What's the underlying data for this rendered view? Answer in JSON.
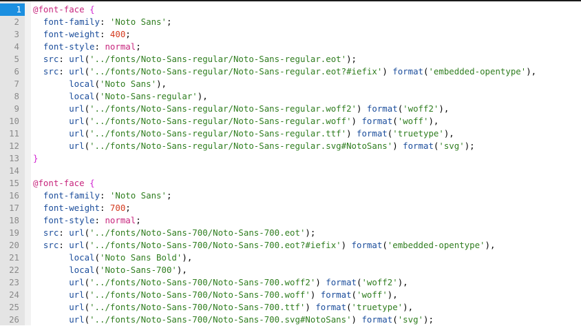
{
  "editor": {
    "current_line": 1,
    "lines": [
      {
        "n": "1",
        "tokens": [
          {
            "c": "t-at",
            "t": "@font-face"
          },
          {
            "c": "t-plain",
            "t": " "
          },
          {
            "c": "t-brace",
            "t": "{"
          }
        ]
      },
      {
        "n": "2",
        "tokens": [
          {
            "c": "t-plain",
            "t": "  "
          },
          {
            "c": "t-prop",
            "t": "font-family"
          },
          {
            "c": "t-plain",
            "t": ": "
          },
          {
            "c": "t-str",
            "t": "'Noto Sans'"
          },
          {
            "c": "t-plain",
            "t": ";"
          }
        ]
      },
      {
        "n": "3",
        "tokens": [
          {
            "c": "t-plain",
            "t": "  "
          },
          {
            "c": "t-prop",
            "t": "font-weight"
          },
          {
            "c": "t-plain",
            "t": ": "
          },
          {
            "c": "t-num",
            "t": "400"
          },
          {
            "c": "t-plain",
            "t": ";"
          }
        ]
      },
      {
        "n": "4",
        "tokens": [
          {
            "c": "t-plain",
            "t": "  "
          },
          {
            "c": "t-prop",
            "t": "font-style"
          },
          {
            "c": "t-plain",
            "t": ": "
          },
          {
            "c": "t-val",
            "t": "normal"
          },
          {
            "c": "t-plain",
            "t": ";"
          }
        ]
      },
      {
        "n": "5",
        "tokens": [
          {
            "c": "t-plain",
            "t": "  "
          },
          {
            "c": "t-prop",
            "t": "src"
          },
          {
            "c": "t-plain",
            "t": ": "
          },
          {
            "c": "t-fn",
            "t": "url"
          },
          {
            "c": "t-plain",
            "t": "("
          },
          {
            "c": "t-str",
            "t": "'../fonts/Noto-Sans-regular/Noto-Sans-regular.eot'"
          },
          {
            "c": "t-plain",
            "t": ");"
          }
        ]
      },
      {
        "n": "6",
        "tokens": [
          {
            "c": "t-plain",
            "t": "  "
          },
          {
            "c": "t-prop",
            "t": "src"
          },
          {
            "c": "t-plain",
            "t": ": "
          },
          {
            "c": "t-fn",
            "t": "url"
          },
          {
            "c": "t-plain",
            "t": "("
          },
          {
            "c": "t-str",
            "t": "'../fonts/Noto-Sans-regular/Noto-Sans-regular.eot?#iefix'"
          },
          {
            "c": "t-plain",
            "t": ") "
          },
          {
            "c": "t-fn",
            "t": "format"
          },
          {
            "c": "t-plain",
            "t": "("
          },
          {
            "c": "t-str",
            "t": "'embedded-opentype'"
          },
          {
            "c": "t-plain",
            "t": "),"
          }
        ]
      },
      {
        "n": "7",
        "tokens": [
          {
            "c": "t-plain",
            "t": "       "
          },
          {
            "c": "t-fn",
            "t": "local"
          },
          {
            "c": "t-plain",
            "t": "("
          },
          {
            "c": "t-str",
            "t": "'Noto Sans'"
          },
          {
            "c": "t-plain",
            "t": "),"
          }
        ]
      },
      {
        "n": "8",
        "tokens": [
          {
            "c": "t-plain",
            "t": "       "
          },
          {
            "c": "t-fn",
            "t": "local"
          },
          {
            "c": "t-plain",
            "t": "("
          },
          {
            "c": "t-str",
            "t": "'Noto-Sans-regular'"
          },
          {
            "c": "t-plain",
            "t": "),"
          }
        ]
      },
      {
        "n": "9",
        "tokens": [
          {
            "c": "t-plain",
            "t": "       "
          },
          {
            "c": "t-fn",
            "t": "url"
          },
          {
            "c": "t-plain",
            "t": "("
          },
          {
            "c": "t-str",
            "t": "'../fonts/Noto-Sans-regular/Noto-Sans-regular.woff2'"
          },
          {
            "c": "t-plain",
            "t": ") "
          },
          {
            "c": "t-fn",
            "t": "format"
          },
          {
            "c": "t-plain",
            "t": "("
          },
          {
            "c": "t-str",
            "t": "'woff2'"
          },
          {
            "c": "t-plain",
            "t": "),"
          }
        ]
      },
      {
        "n": "10",
        "tokens": [
          {
            "c": "t-plain",
            "t": "       "
          },
          {
            "c": "t-fn",
            "t": "url"
          },
          {
            "c": "t-plain",
            "t": "("
          },
          {
            "c": "t-str",
            "t": "'../fonts/Noto-Sans-regular/Noto-Sans-regular.woff'"
          },
          {
            "c": "t-plain",
            "t": ") "
          },
          {
            "c": "t-fn",
            "t": "format"
          },
          {
            "c": "t-plain",
            "t": "("
          },
          {
            "c": "t-str",
            "t": "'woff'"
          },
          {
            "c": "t-plain",
            "t": "),"
          }
        ]
      },
      {
        "n": "11",
        "tokens": [
          {
            "c": "t-plain",
            "t": "       "
          },
          {
            "c": "t-fn",
            "t": "url"
          },
          {
            "c": "t-plain",
            "t": "("
          },
          {
            "c": "t-str",
            "t": "'../fonts/Noto-Sans-regular/Noto-Sans-regular.ttf'"
          },
          {
            "c": "t-plain",
            "t": ") "
          },
          {
            "c": "t-fn",
            "t": "format"
          },
          {
            "c": "t-plain",
            "t": "("
          },
          {
            "c": "t-str",
            "t": "'truetype'"
          },
          {
            "c": "t-plain",
            "t": "),"
          }
        ]
      },
      {
        "n": "12",
        "tokens": [
          {
            "c": "t-plain",
            "t": "       "
          },
          {
            "c": "t-fn",
            "t": "url"
          },
          {
            "c": "t-plain",
            "t": "("
          },
          {
            "c": "t-str",
            "t": "'../fonts/Noto-Sans-regular/Noto-Sans-regular.svg#NotoSans'"
          },
          {
            "c": "t-plain",
            "t": ") "
          },
          {
            "c": "t-fn",
            "t": "format"
          },
          {
            "c": "t-plain",
            "t": "("
          },
          {
            "c": "t-str",
            "t": "'svg'"
          },
          {
            "c": "t-plain",
            "t": ");"
          }
        ]
      },
      {
        "n": "13",
        "tokens": [
          {
            "c": "t-brace",
            "t": "}"
          }
        ]
      },
      {
        "n": "14",
        "tokens": []
      },
      {
        "n": "15",
        "tokens": [
          {
            "c": "t-at",
            "t": "@font-face"
          },
          {
            "c": "t-plain",
            "t": " "
          },
          {
            "c": "t-brace",
            "t": "{"
          }
        ]
      },
      {
        "n": "16",
        "tokens": [
          {
            "c": "t-plain",
            "t": "  "
          },
          {
            "c": "t-prop",
            "t": "font-family"
          },
          {
            "c": "t-plain",
            "t": ": "
          },
          {
            "c": "t-str",
            "t": "'Noto Sans'"
          },
          {
            "c": "t-plain",
            "t": ";"
          }
        ]
      },
      {
        "n": "17",
        "tokens": [
          {
            "c": "t-plain",
            "t": "  "
          },
          {
            "c": "t-prop",
            "t": "font-weight"
          },
          {
            "c": "t-plain",
            "t": ": "
          },
          {
            "c": "t-num",
            "t": "700"
          },
          {
            "c": "t-plain",
            "t": ";"
          }
        ]
      },
      {
        "n": "18",
        "tokens": [
          {
            "c": "t-plain",
            "t": "  "
          },
          {
            "c": "t-prop",
            "t": "font-style"
          },
          {
            "c": "t-plain",
            "t": ": "
          },
          {
            "c": "t-val",
            "t": "normal"
          },
          {
            "c": "t-plain",
            "t": ";"
          }
        ]
      },
      {
        "n": "19",
        "tokens": [
          {
            "c": "t-plain",
            "t": "  "
          },
          {
            "c": "t-prop",
            "t": "src"
          },
          {
            "c": "t-plain",
            "t": ": "
          },
          {
            "c": "t-fn",
            "t": "url"
          },
          {
            "c": "t-plain",
            "t": "("
          },
          {
            "c": "t-str",
            "t": "'../fonts/Noto-Sans-700/Noto-Sans-700.eot'"
          },
          {
            "c": "t-plain",
            "t": ");"
          }
        ]
      },
      {
        "n": "20",
        "tokens": [
          {
            "c": "t-plain",
            "t": "  "
          },
          {
            "c": "t-prop",
            "t": "src"
          },
          {
            "c": "t-plain",
            "t": ": "
          },
          {
            "c": "t-fn",
            "t": "url"
          },
          {
            "c": "t-plain",
            "t": "("
          },
          {
            "c": "t-str",
            "t": "'../fonts/Noto-Sans-700/Noto-Sans-700.eot?#iefix'"
          },
          {
            "c": "t-plain",
            "t": ") "
          },
          {
            "c": "t-fn",
            "t": "format"
          },
          {
            "c": "t-plain",
            "t": "("
          },
          {
            "c": "t-str",
            "t": "'embedded-opentype'"
          },
          {
            "c": "t-plain",
            "t": "),"
          }
        ]
      },
      {
        "n": "21",
        "tokens": [
          {
            "c": "t-plain",
            "t": "       "
          },
          {
            "c": "t-fn",
            "t": "local"
          },
          {
            "c": "t-plain",
            "t": "("
          },
          {
            "c": "t-str",
            "t": "'Noto Sans Bold'"
          },
          {
            "c": "t-plain",
            "t": "),"
          }
        ]
      },
      {
        "n": "22",
        "tokens": [
          {
            "c": "t-plain",
            "t": "       "
          },
          {
            "c": "t-fn",
            "t": "local"
          },
          {
            "c": "t-plain",
            "t": "("
          },
          {
            "c": "t-str",
            "t": "'Noto-Sans-700'"
          },
          {
            "c": "t-plain",
            "t": "),"
          }
        ]
      },
      {
        "n": "23",
        "tokens": [
          {
            "c": "t-plain",
            "t": "       "
          },
          {
            "c": "t-fn",
            "t": "url"
          },
          {
            "c": "t-plain",
            "t": "("
          },
          {
            "c": "t-str",
            "t": "'../fonts/Noto-Sans-700/Noto-Sans-700.woff2'"
          },
          {
            "c": "t-plain",
            "t": ") "
          },
          {
            "c": "t-fn",
            "t": "format"
          },
          {
            "c": "t-plain",
            "t": "("
          },
          {
            "c": "t-str",
            "t": "'woff2'"
          },
          {
            "c": "t-plain",
            "t": "),"
          }
        ]
      },
      {
        "n": "24",
        "tokens": [
          {
            "c": "t-plain",
            "t": "       "
          },
          {
            "c": "t-fn",
            "t": "url"
          },
          {
            "c": "t-plain",
            "t": "("
          },
          {
            "c": "t-str",
            "t": "'../fonts/Noto-Sans-700/Noto-Sans-700.woff'"
          },
          {
            "c": "t-plain",
            "t": ") "
          },
          {
            "c": "t-fn",
            "t": "format"
          },
          {
            "c": "t-plain",
            "t": "("
          },
          {
            "c": "t-str",
            "t": "'woff'"
          },
          {
            "c": "t-plain",
            "t": "),"
          }
        ]
      },
      {
        "n": "25",
        "tokens": [
          {
            "c": "t-plain",
            "t": "       "
          },
          {
            "c": "t-fn",
            "t": "url"
          },
          {
            "c": "t-plain",
            "t": "("
          },
          {
            "c": "t-str",
            "t": "'../fonts/Noto-Sans-700/Noto-Sans-700.ttf'"
          },
          {
            "c": "t-plain",
            "t": ") "
          },
          {
            "c": "t-fn",
            "t": "format"
          },
          {
            "c": "t-plain",
            "t": "("
          },
          {
            "c": "t-str",
            "t": "'truetype'"
          },
          {
            "c": "t-plain",
            "t": "),"
          }
        ]
      },
      {
        "n": "26",
        "tokens": [
          {
            "c": "t-plain",
            "t": "       "
          },
          {
            "c": "t-fn",
            "t": "url"
          },
          {
            "c": "t-plain",
            "t": "("
          },
          {
            "c": "t-str",
            "t": "'../fonts/Noto-Sans-700/Noto-Sans-700.svg#NotoSans'"
          },
          {
            "c": "t-plain",
            "t": ") "
          },
          {
            "c": "t-fn",
            "t": "format"
          },
          {
            "c": "t-plain",
            "t": "("
          },
          {
            "c": "t-str",
            "t": "'svg'"
          },
          {
            "c": "t-plain",
            "t": ");"
          }
        ]
      }
    ]
  }
}
